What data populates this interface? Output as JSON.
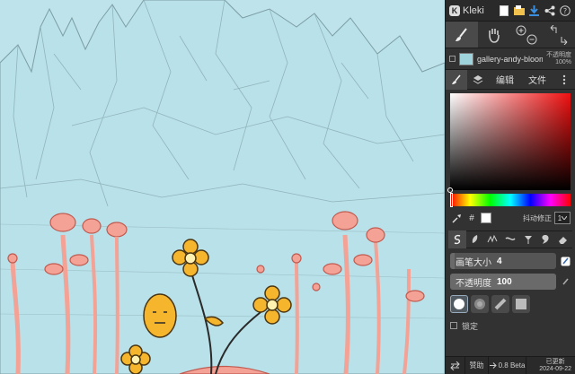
{
  "app": {
    "name": "Kleki"
  },
  "header": {
    "icons": [
      "new-image-icon",
      "open-folder-icon",
      "download-icon",
      "share-icon",
      "help-icon"
    ]
  },
  "tools": [
    {
      "name": "brush",
      "icon": "brush-icon",
      "active": true
    },
    {
      "name": "hand",
      "icon": "hand-icon",
      "active": false
    },
    {
      "name": "zoom",
      "icon": "zoom-icon",
      "active": false
    },
    {
      "name": "undo-redo",
      "icon": "undo-redo-icon",
      "active": false
    }
  ],
  "layer": {
    "name": "gallery-andy-bloom.w",
    "opacity_label": "不透明度",
    "opacity_value": "100%"
  },
  "tabs": [
    {
      "label": "",
      "icon": "brush-icon",
      "active": true
    },
    {
      "label": "",
      "icon": "layers-icon",
      "active": false
    },
    {
      "label": "编辑",
      "active": false
    },
    {
      "label": "文件",
      "active": false
    },
    {
      "label": "",
      "icon": "more-icon",
      "active": false
    }
  ],
  "color": {
    "primary": "#000000",
    "secondary": "#ffffff",
    "hue_base": "#f01010",
    "hex_button": "#",
    "stabilizer_label": "抖动修正",
    "stabilizer_value": "1"
  },
  "brushes": [
    "pen",
    "blend",
    "sketchy",
    "pixel",
    "chemy",
    "smudge",
    "eraser"
  ],
  "brush_settings": {
    "size_label": "画笔大小",
    "size_value": "4",
    "size_fraction": 0.04,
    "opacity_label": "不透明度",
    "opacity_value": "100",
    "opacity_fraction": 1.0,
    "lock_label": "锁定"
  },
  "shapes": [
    "circle-hard",
    "circle-soft",
    "chalk",
    "square"
  ],
  "footer": {
    "donate_label": "赞助",
    "version_label": "0.8 Beta",
    "updated_label": "已更新",
    "updated_date": "2024-09-22"
  }
}
